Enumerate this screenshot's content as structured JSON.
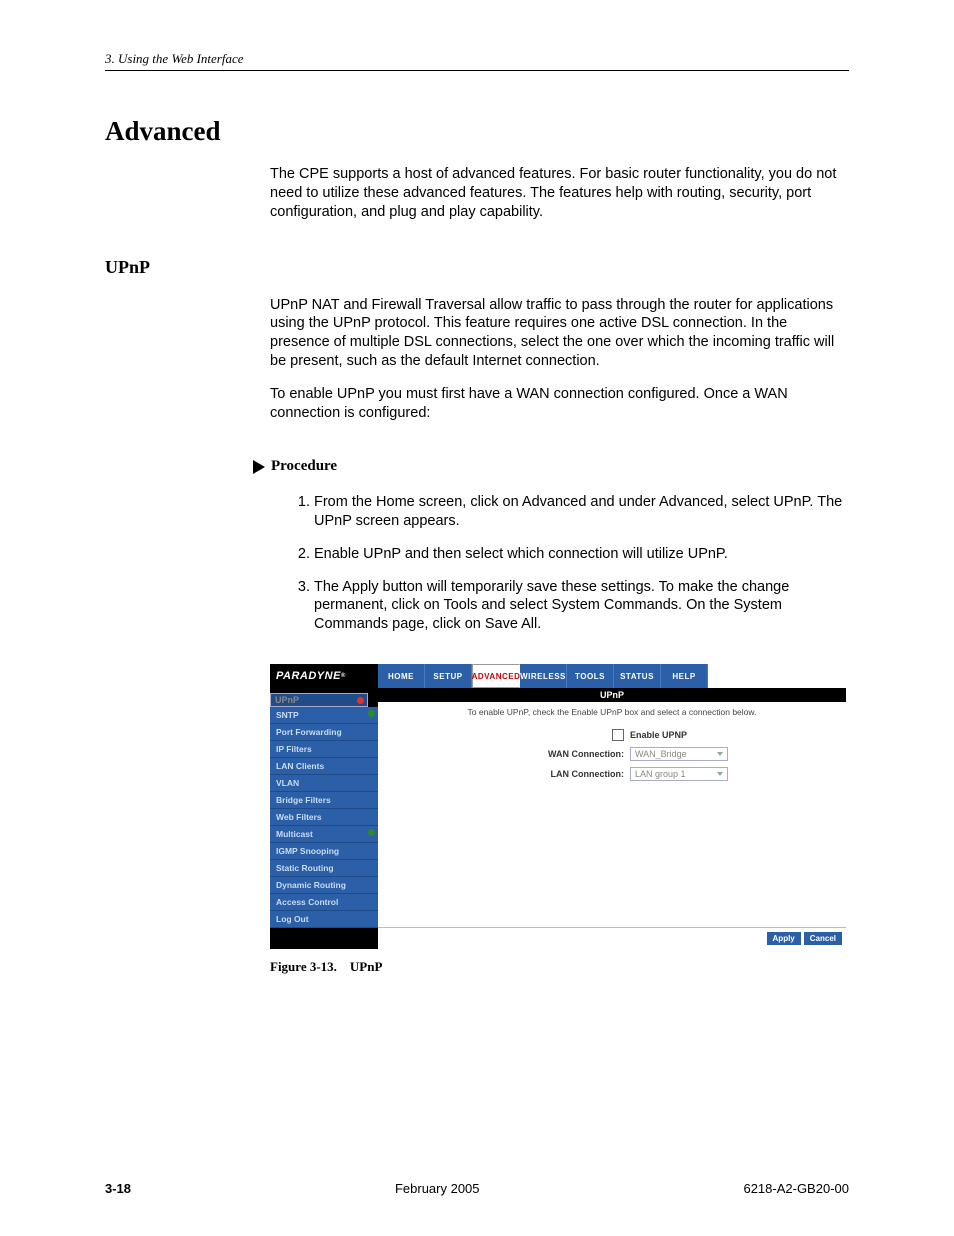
{
  "header": "3. Using the Web Interface",
  "title": "Advanced",
  "intro": "The CPE supports a host of advanced features. For basic router functionality, you do not need to utilize these advanced features. The features help with routing, security, port configuration, and plug and play capability.",
  "section2": "UPnP",
  "upnp_p1": "UPnP NAT and Firewall Traversal allow traffic to pass through the router for applications using the UPnP protocol. This feature requires one active DSL connection. In the presence of multiple DSL connections, select the one over which the incoming traffic will be present, such as the default Internet connection.",
  "upnp_p2": "To enable UPnP you must first have a WAN connection configured. Once a WAN connection is configured:",
  "procedure_label": "Procedure",
  "steps": [
    "From the Home screen, click on Advanced and under Advanced, select UPnP. The UPnP screen appears.",
    "Enable UPnP and then select which connection will utilize UPnP.",
    "The Apply button will temporarily save these settings. To make the change permanent, click on Tools and select System Commands. On the System Commands page, click on Save All."
  ],
  "ss": {
    "brand": "PARADYNE",
    "tabs": [
      "HOME",
      "SETUP",
      "ADVANCED",
      "WIRELESS",
      "TOOLS",
      "STATUS",
      "HELP"
    ],
    "active_tab": "ADVANCED",
    "side": [
      "UPnP",
      "SNTP",
      "Port Forwarding",
      "IP Filters",
      "LAN Clients",
      "VLAN",
      "Bridge Filters",
      "Web Filters",
      "Multicast",
      "IGMP Snooping",
      "Static Routing",
      "Dynamic Routing",
      "Access Control",
      "Log Out"
    ],
    "content_title": "UPnP",
    "content_sub": "To enable UPnP, check the Enable UPnP box and select a connection below.",
    "enable_label": "Enable UPNP",
    "wan_label": "WAN Connection:",
    "wan_val": "WAN_Bridge",
    "lan_label": "LAN Connection:",
    "lan_val": "LAN group 1",
    "apply": "Apply",
    "cancel": "Cancel"
  },
  "figure": "Figure 3-13. UPnP",
  "footer": {
    "page": "3-18",
    "date": "February 2005",
    "doc": "6218-A2-GB20-00"
  }
}
